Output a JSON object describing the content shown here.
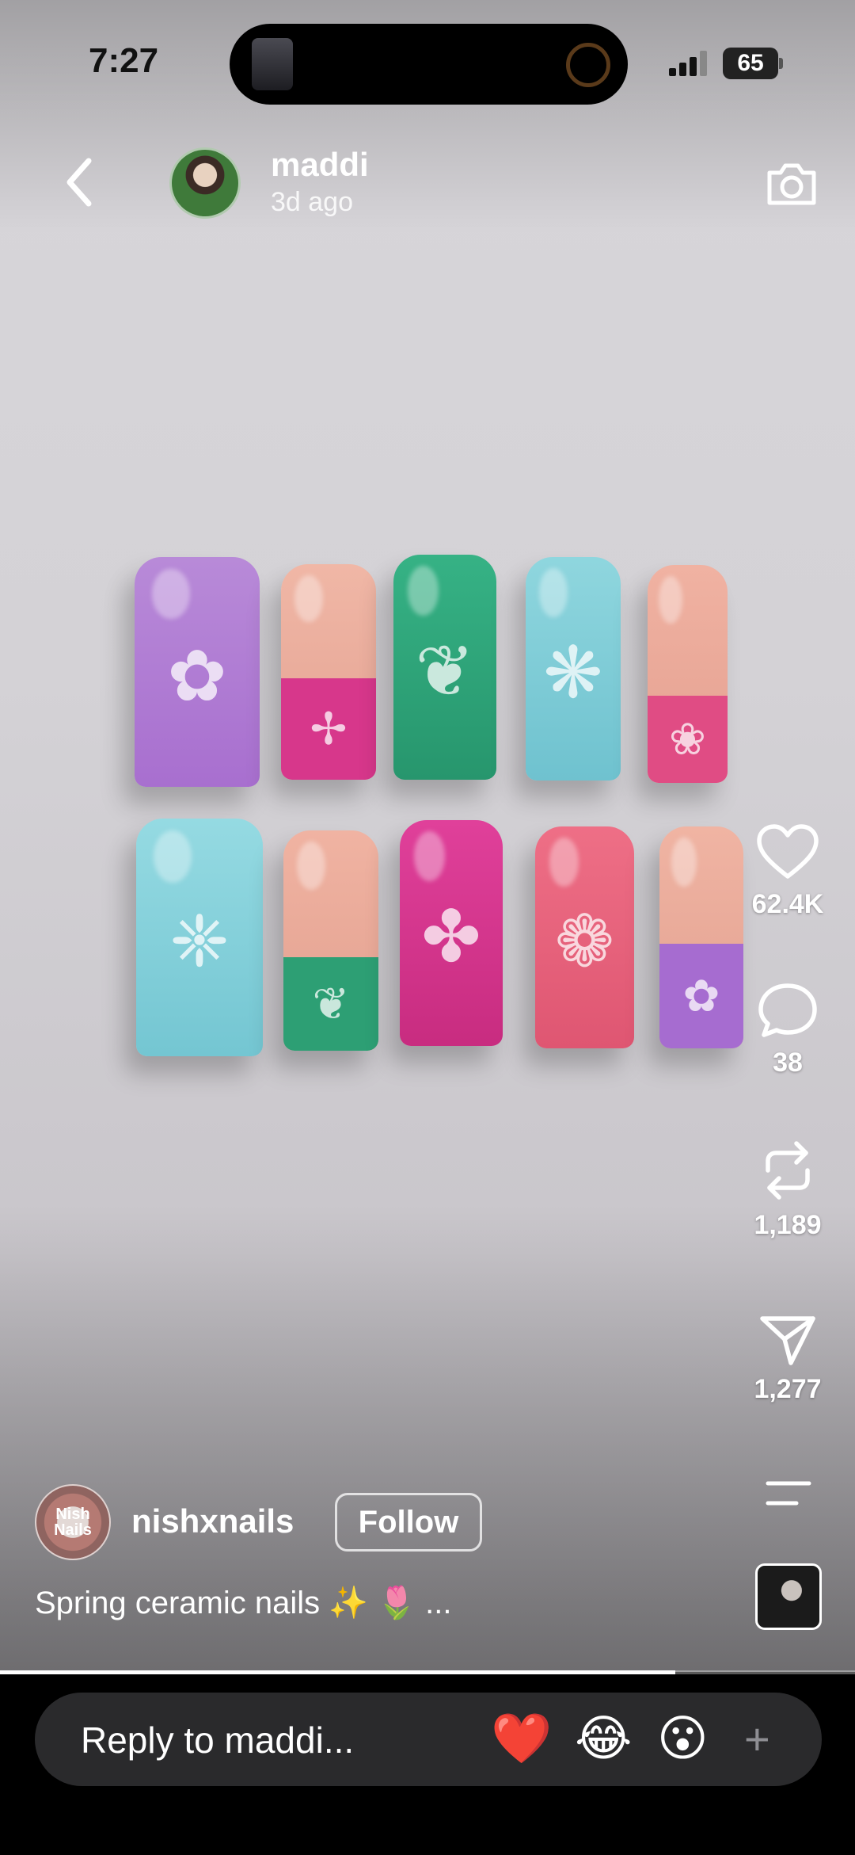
{
  "status_bar": {
    "time": "7:27",
    "battery": "65"
  },
  "story": {
    "user_name": "maddi",
    "time_ago": "3d ago"
  },
  "actions": {
    "likes": "62.4K",
    "comments": "38",
    "reposts": "1,189",
    "shares": "1,277"
  },
  "author": {
    "avatar_text": "Nish Nails",
    "name": "nishxnails",
    "follow_label": "Follow",
    "caption": "Spring ceramic nails ✨ 🌷 ..."
  },
  "progress": 0.79,
  "reply": {
    "placeholder": "Reply to maddi...",
    "reactions": [
      "❤️",
      "😂",
      "😮"
    ],
    "more": "+"
  },
  "colors": {
    "purple": "#b07fd6",
    "pink": "#d6388a",
    "green": "#2fa37a",
    "teal": "#7fcfd9",
    "nude": "#e8a797",
    "coral": "#e8607a"
  },
  "icons": [
    "back-icon",
    "camera-icon",
    "heart-icon",
    "comment-icon",
    "repost-icon",
    "share-icon",
    "menu-icon"
  ]
}
